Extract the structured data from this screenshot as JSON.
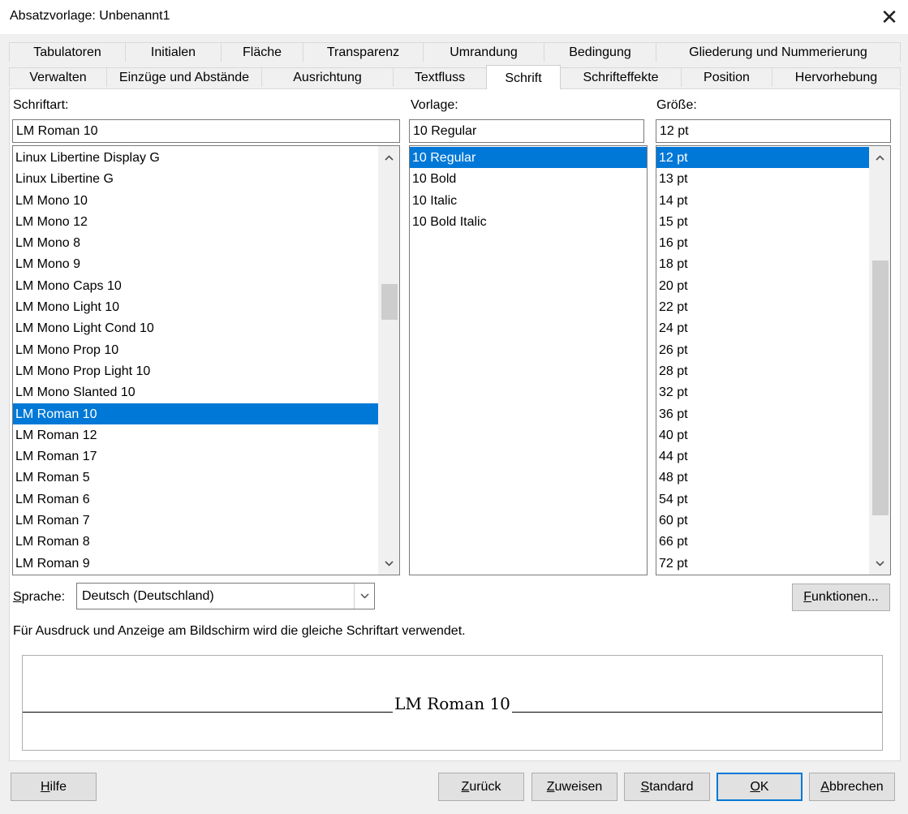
{
  "window": {
    "title": "Absatzvorlage: Unbenannt1",
    "close_glyph": "✕"
  },
  "tabs_row1": [
    "Tabulatoren",
    "Initialen",
    "Fläche",
    "Transparenz",
    "Umrandung",
    "Bedingung",
    "Gliederung und Nummerierung"
  ],
  "tabs_row2": [
    "Verwalten",
    "Einzüge und Abstände",
    "Ausrichtung",
    "Textfluss",
    "Schrift",
    "Schrifteffekte",
    "Position",
    "Hervorhebung"
  ],
  "active_tab": "Schrift",
  "font": {
    "label": "Schriftart:",
    "value": "LM Roman 10",
    "items": [
      "Linux Libertine Display G",
      "Linux Libertine G",
      "LM Mono 10",
      "LM Mono 12",
      "LM Mono 8",
      "LM Mono 9",
      "LM Mono Caps 10",
      "LM Mono Light 10",
      "LM Mono Light Cond 10",
      "LM Mono Prop 10",
      "LM Mono Prop Light 10",
      "LM Mono Slanted 10",
      "LM Roman 10",
      "LM Roman 12",
      "LM Roman 17",
      "LM Roman 5",
      "LM Roman 6",
      "LM Roman 7",
      "LM Roman 8",
      "LM Roman 9"
    ],
    "selected": "LM Roman 10"
  },
  "style": {
    "label": "Vorlage:",
    "value": "10 Regular",
    "items": [
      "10 Regular",
      "10 Bold",
      "10 Italic",
      "10 Bold Italic"
    ],
    "selected": "10 Regular"
  },
  "size": {
    "label": "Größe:",
    "value": "12 pt",
    "items": [
      "12 pt",
      "13 pt",
      "14 pt",
      "15 pt",
      "16 pt",
      "18 pt",
      "20 pt",
      "22 pt",
      "24 pt",
      "26 pt",
      "28 pt",
      "32 pt",
      "36 pt",
      "40 pt",
      "44 pt",
      "48 pt",
      "54 pt",
      "60 pt",
      "66 pt",
      "72 pt"
    ],
    "selected": "12 pt"
  },
  "language": {
    "label_pre": "",
    "label_mnemonic": "S",
    "label_post": "prache:",
    "value": "Deutsch (Deutschland)"
  },
  "functions_button": {
    "mnemonic": "F",
    "rest": "unktionen..."
  },
  "info_text": "Für Ausdruck und Anzeige am Bildschirm wird die gleiche Schriftart verwendet.",
  "preview_text": "LM Roman 10",
  "buttons": {
    "help": {
      "pre": "",
      "mnemonic": "H",
      "post": "ilfe"
    },
    "back": {
      "pre": "",
      "mnemonic": "Z",
      "post": "urück"
    },
    "apply": {
      "pre": "",
      "mnemonic": "Z",
      "post": "uweisen"
    },
    "standard": {
      "pre": "",
      "mnemonic": "S",
      "post": "tandard"
    },
    "ok": {
      "pre": "",
      "mnemonic": "O",
      "post": "K"
    },
    "cancel": {
      "pre": "",
      "mnemonic": "A",
      "post": "bbrechen"
    }
  },
  "colors": {
    "selection": "#0078d7",
    "dialog_bg": "#f0f0f0",
    "default_button_border": "#0078d7"
  },
  "icons": {
    "up_arrow": "chevron-up-icon",
    "down_arrow": "chevron-down-icon",
    "dropdown": "chevron-down-icon",
    "close": "close-icon"
  }
}
